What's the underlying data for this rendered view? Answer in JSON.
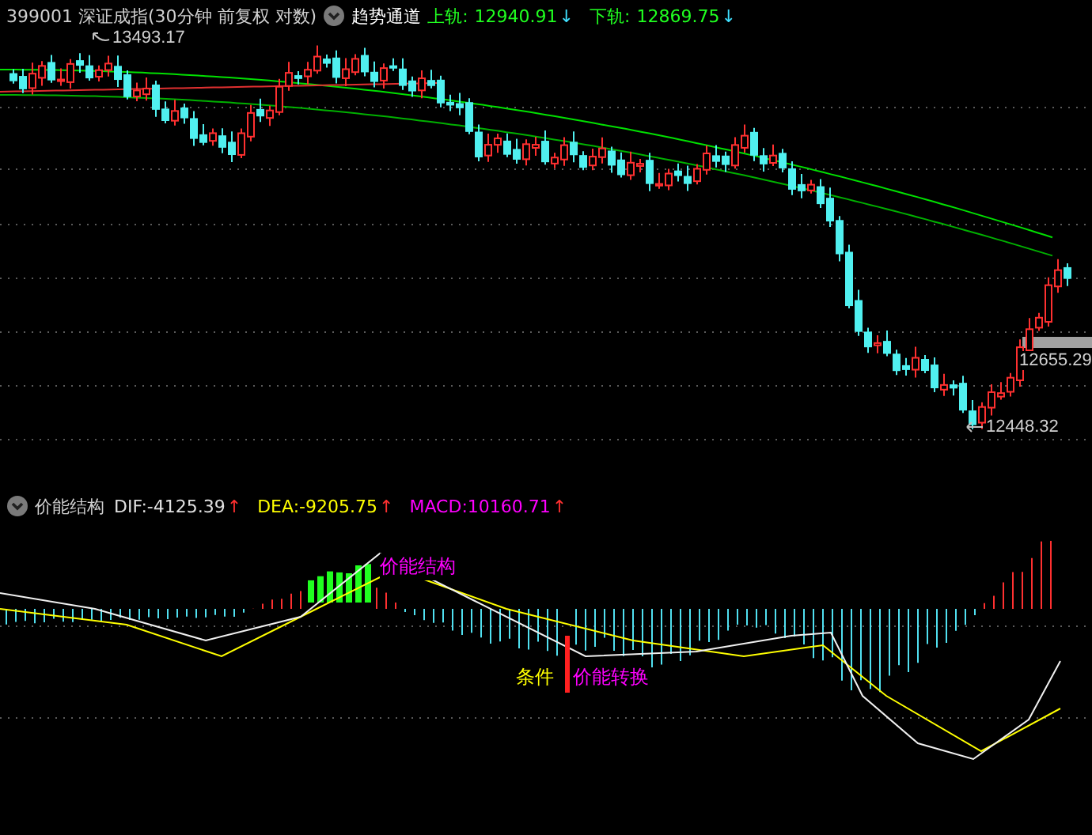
{
  "header": {
    "code": "399001",
    "name": "深证成指(30分钟 前复权 对数)",
    "indicator": "趋势通道",
    "upper_label": "上轨:",
    "upper_value": "12940.91",
    "upper_arrow": "↓",
    "lower_label": "下轨:",
    "lower_value": "12869.75",
    "lower_arrow": "↓"
  },
  "price_labels": [
    {
      "kind": "high",
      "text": "13493.17"
    },
    {
      "kind": "current",
      "text": "12655.29"
    },
    {
      "kind": "low",
      "text": "12448.32"
    }
  ],
  "macd_header": {
    "indicator": "价能结构",
    "items": [
      {
        "label": "DIF:",
        "value": "-4125.39",
        "arrow": "↑",
        "color": "#e0e0e0"
      },
      {
        "label": "DEA:",
        "value": "-9205.75",
        "arrow": "↑",
        "color": "#ffff00"
      },
      {
        "label": "MACD:",
        "value": "10160.71",
        "arrow": "↑",
        "color": "#ff00ff"
      }
    ]
  },
  "signals": [
    {
      "kind": "top",
      "text": "价能结构",
      "color": "#ff00ff"
    },
    {
      "kind": "cond",
      "text": "条件",
      "color": "#ffff00"
    },
    {
      "kind": "turn",
      "text": "价能转换",
      "color": "#ff00ff"
    }
  ]
}
